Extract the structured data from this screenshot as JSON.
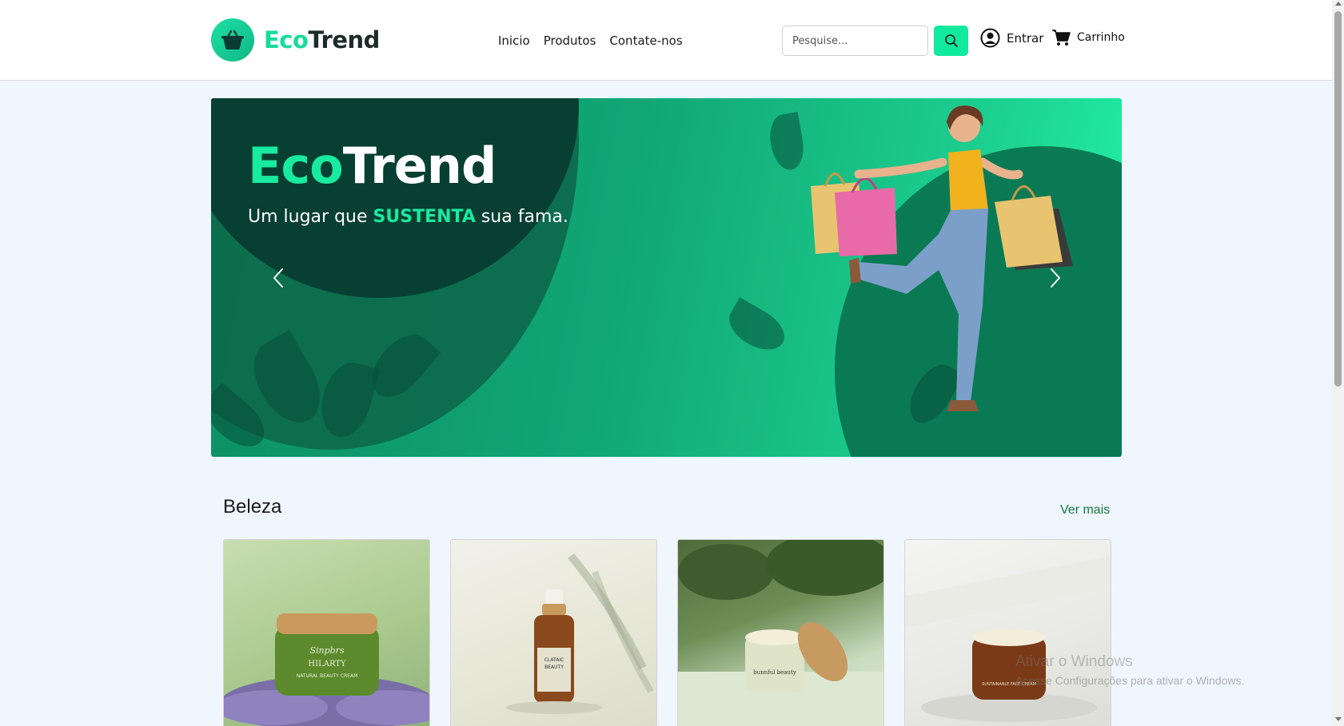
{
  "brand": {
    "eco": "Eco",
    "trend": "Trend"
  },
  "nav": {
    "items": [
      "Inicio",
      "Produtos",
      "Contate-nos"
    ]
  },
  "search": {
    "placeholder": "Pesquise..."
  },
  "account": {
    "login_label": "Entrar",
    "cart_label": "Carrinho"
  },
  "hero": {
    "title_eco": "Eco",
    "title_trend": "Trend",
    "subtitle_before": "Um lugar que ",
    "subtitle_highlight": "SUSTENTA",
    "subtitle_after": " sua fama."
  },
  "section": {
    "title": "Beleza",
    "see_more": "Ver mais"
  },
  "products": [
    {
      "label_brand": "Sinpbrs",
      "label_name": "HILARTY",
      "label_sub": "NATURAL BEAUTY CREAM"
    },
    {
      "label_brand": "CLATAIC",
      "label_name": "BEAUTY",
      "label_sub": ""
    },
    {
      "label_brand": "bunnful beauty",
      "label_name": "",
      "label_sub": ""
    },
    {
      "label_brand": "",
      "label_name": "",
      "label_sub": "SUSTAINABLE FACE CREAM"
    }
  ],
  "watermark": {
    "line1": "Ativar o Windows",
    "line2": "Acesse Configurações para ativar o Windows."
  },
  "colors": {
    "accent": "#10ea9e",
    "brand_dark": "#1d2b2a",
    "link_green": "#137a3f",
    "hero_dark": "#083f33"
  }
}
